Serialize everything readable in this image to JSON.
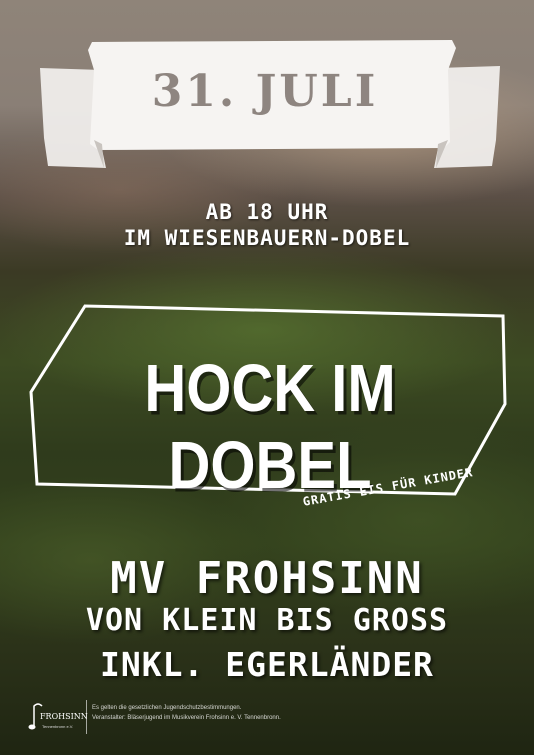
{
  "banner": {
    "date": "31. JULI"
  },
  "info": {
    "time": "AB 18 UHR",
    "location": "IM WIESENBAUERN-DOBEL"
  },
  "event": {
    "title": "HOCK IM DOBEL",
    "tagline": "GRATIS EIS FÜR KINDER"
  },
  "lineup": {
    "line1": "MV FROHSINN",
    "line2": "VON KLEIN BIS GROSS",
    "line3": "INKL. EGERLÄNDER"
  },
  "footer": {
    "logo_text": "FROHSINN",
    "logo_subtext": "Tennenbronn e.V.",
    "notice": "Es gelten die gesetzlichen Jugendschutzbestimmungen.",
    "organizer": "Veranstalter: Bläserjugend im Musikverein Frohsinn e. V. Tennenbronn."
  },
  "colors": {
    "text": "#ffffff",
    "banner": "#ffffff",
    "date": "#8e8580"
  }
}
